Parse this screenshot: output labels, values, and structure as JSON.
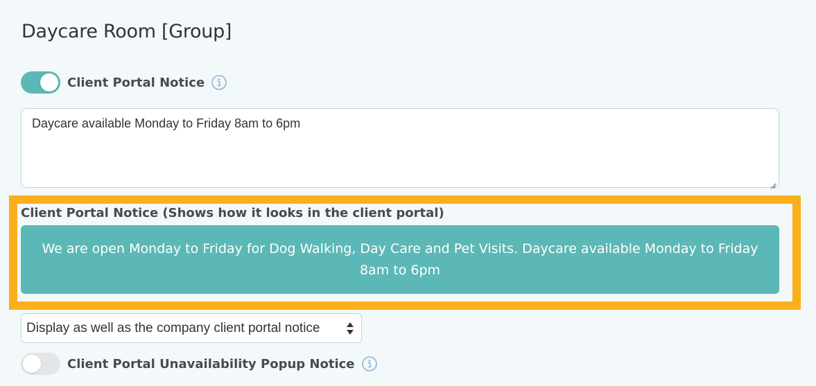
{
  "page": {
    "title": "Daycare Room [Group]"
  },
  "client_portal_notice": {
    "toggle_label": "Client Portal Notice",
    "enabled": true,
    "textarea_value": "Daycare available Monday to Friday 8am to 6pm"
  },
  "preview": {
    "heading": "Client Portal Notice (Shows how it looks in the client portal)",
    "banner_text": "We are open Monday to Friday for Dog Walking, Day Care and Pet Visits. Daycare available Monday to Friday 8am to 6pm"
  },
  "display_select": {
    "selected": "Display as well as the company client portal notice"
  },
  "unavailability_popup": {
    "toggle_label": "Client Portal Unavailability Popup Notice",
    "enabled": false
  },
  "icons": {
    "info": "info-icon",
    "select_arrows": "sort-arrows-icon"
  },
  "colors": {
    "accent_teal": "#5bb8b6",
    "highlight_orange": "#fbaf1b",
    "background": "#f3f8fa"
  }
}
